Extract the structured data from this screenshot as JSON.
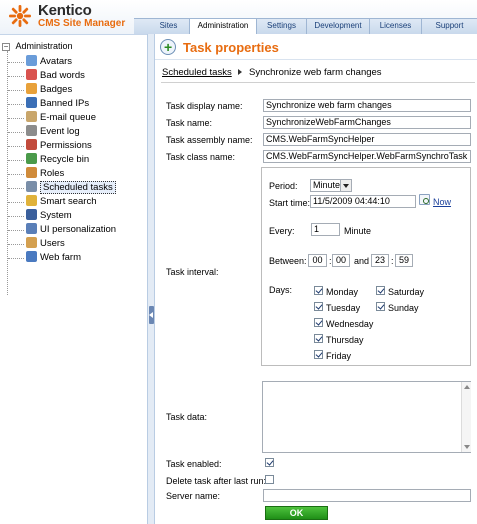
{
  "app": {
    "logo_name": "Kentico",
    "logo_sub": "CMS Site Manager",
    "accent": "#e86c10"
  },
  "tabs": [
    {
      "label": "Sites"
    },
    {
      "label": "Administration",
      "active": true
    },
    {
      "label": "Settings"
    },
    {
      "label": "Development"
    },
    {
      "label": "Licenses"
    },
    {
      "label": "Support"
    }
  ],
  "tree": {
    "root_label": "Administration",
    "items": [
      {
        "label": "Avatars",
        "icon": "avatars-icon",
        "color": "#6a9cd9"
      },
      {
        "label": "Bad words",
        "icon": "bad-words-icon",
        "color": "#d9534f"
      },
      {
        "label": "Badges",
        "icon": "badges-icon",
        "color": "#e8a13a"
      },
      {
        "label": "Banned IPs",
        "icon": "banned-ips-icon",
        "color": "#3b6fb6"
      },
      {
        "label": "E-mail queue",
        "icon": "email-queue-icon",
        "color": "#c9a66b"
      },
      {
        "label": "Event log",
        "icon": "event-log-icon",
        "color": "#8c8c8c"
      },
      {
        "label": "Permissions",
        "icon": "permissions-icon",
        "color": "#c24b3c"
      },
      {
        "label": "Recycle bin",
        "icon": "recycle-bin-icon",
        "color": "#4a9a4a"
      },
      {
        "label": "Roles",
        "icon": "roles-icon",
        "color": "#d08b3a"
      },
      {
        "label": "Scheduled tasks",
        "icon": "scheduled-tasks-icon",
        "color": "#7a8ea8",
        "selected": true
      },
      {
        "label": "Smart search",
        "icon": "smart-search-icon",
        "color": "#e0b23a"
      },
      {
        "label": "System",
        "icon": "system-icon",
        "color": "#3a5f9c"
      },
      {
        "label": "UI personalization",
        "icon": "ui-personalization-icon",
        "color": "#5a7fb8"
      },
      {
        "label": "Users",
        "icon": "users-icon",
        "color": "#d4a050"
      },
      {
        "label": "Web farm",
        "icon": "web-farm-icon",
        "color": "#4a7ac0"
      }
    ]
  },
  "page": {
    "title": "Task properties",
    "breadcrumb_link": "Scheduled tasks",
    "breadcrumb_current": "Synchronize web farm changes"
  },
  "form": {
    "display_name_label": "Task display name:",
    "display_name_value": "Synchronize web farm changes",
    "name_label": "Task name:",
    "name_value": "SynchronizeWebFarmChanges",
    "assembly_label": "Task assembly name:",
    "assembly_value": "CMS.WebFarmSyncHelper",
    "class_label": "Task class name:",
    "class_value": "CMS.WebFarmSyncHelper.WebFarmSynchroTask",
    "interval_label": "Task interval:",
    "period_label": "Period:",
    "period_value": "Minute",
    "start_time_label": "Start time:",
    "start_time_value": "11/5/2009 04:44:10",
    "now_label": "Now",
    "every_label": "Every:",
    "every_value": "1",
    "every_unit": "Minute",
    "between_label": "Between:",
    "between_from_h": "00",
    "between_from_m": "00",
    "between_and": "and",
    "between_to_h": "23",
    "between_to_m": "59",
    "colon": ":",
    "days_label": "Days:",
    "days": [
      {
        "label": "Monday",
        "checked": true
      },
      {
        "label": "Tuesday",
        "checked": true
      },
      {
        "label": "Wednesday",
        "checked": true
      },
      {
        "label": "Thursday",
        "checked": true
      },
      {
        "label": "Friday",
        "checked": true
      },
      {
        "label": "Saturday",
        "checked": true
      },
      {
        "label": "Sunday",
        "checked": true
      }
    ],
    "task_data_label": "Task data:",
    "task_data_value": "",
    "enabled_label": "Task enabled:",
    "enabled_checked": true,
    "delete_label": "Delete task after last run:",
    "delete_checked": false,
    "server_label": "Server name:",
    "server_value": "",
    "ok_label": "OK"
  }
}
